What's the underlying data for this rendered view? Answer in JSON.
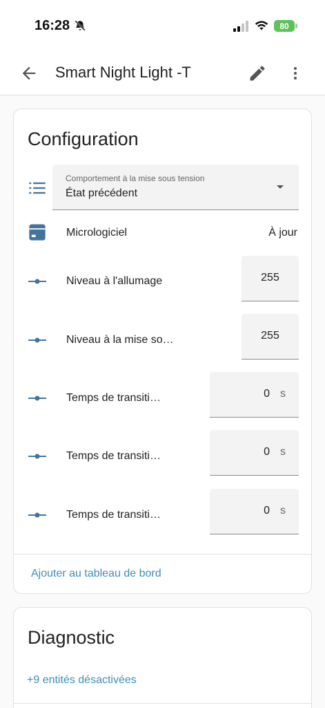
{
  "status": {
    "time": "16:28",
    "battery": "80"
  },
  "header": {
    "title": "Smart Night Light -T"
  },
  "config": {
    "title": "Configuration",
    "power_on_behavior": {
      "label": "Comportement à la mise sous tension",
      "value": "État précédent"
    },
    "firmware": {
      "label": "Micrologiciel",
      "value": "À jour"
    },
    "rows": [
      {
        "label": "Niveau à l'allumage",
        "value": "255",
        "unit": ""
      },
      {
        "label": "Niveau à la mise so…",
        "value": "255",
        "unit": ""
      },
      {
        "label": "Temps de transiti…",
        "value": "0",
        "unit": "s"
      },
      {
        "label": "Temps de transiti…",
        "value": "0",
        "unit": "s"
      },
      {
        "label": "Temps de transiti…",
        "value": "0",
        "unit": "s"
      }
    ],
    "add_to_dashboard": "Ajouter au tableau de bord"
  },
  "diagnostic": {
    "title": "Diagnostic",
    "disabled_entities": "+9 entités désactivées"
  },
  "colors": {
    "icon": "#44739e",
    "link": "#3d8eb9",
    "battery": "#5cc25a"
  }
}
